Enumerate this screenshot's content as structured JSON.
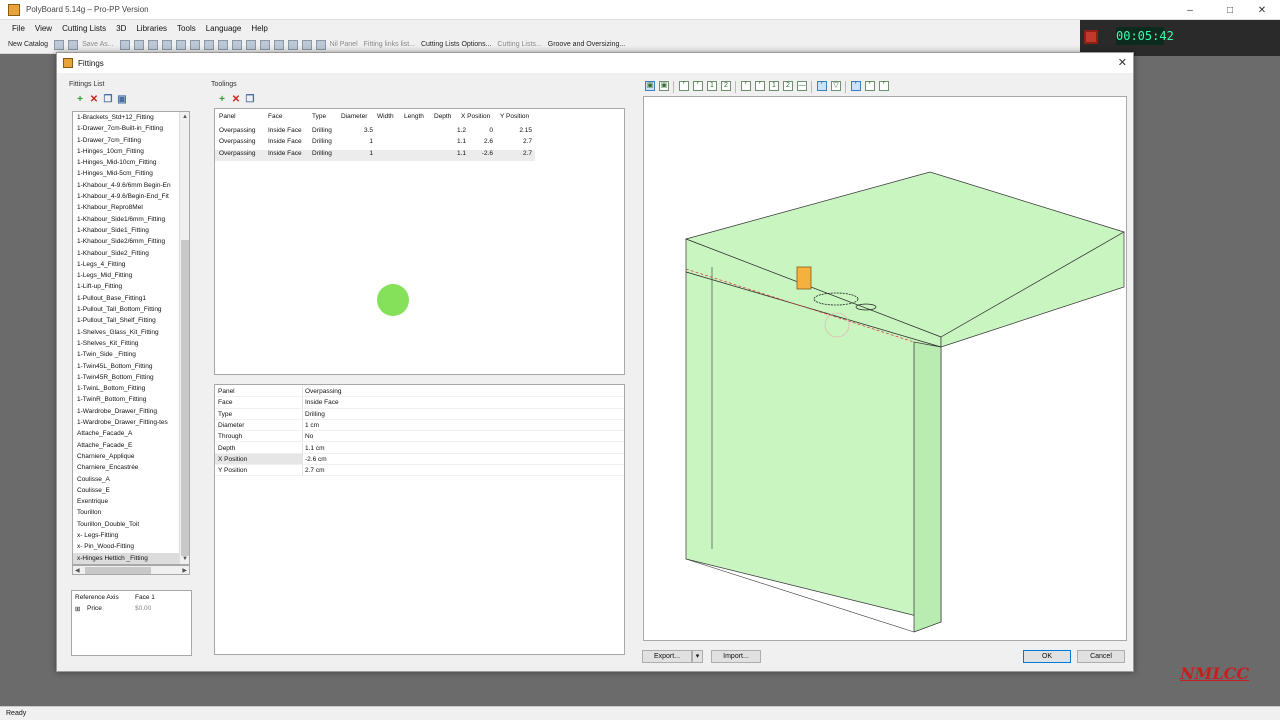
{
  "app": {
    "title": "PolyBoard 5.14g – Pro-PP Version",
    "menu": [
      "File",
      "View",
      "Cutting Lists",
      "3D",
      "Libraries",
      "Tools",
      "Language",
      "Help"
    ],
    "toolbar": {
      "new_catalog": "New Catalog",
      "save_as": "Save As...",
      "nil_panel": "Nil Panel",
      "fitting_links": "Fitting links list...",
      "cutting_list_options": "Cutting Lists Options...",
      "cutting_lists": "Cutting Lists...",
      "groove_oversizing": "Groove and Oversizing..."
    },
    "timer": "00:05:42",
    "status": "Ready",
    "watermark": "NMLCC"
  },
  "dialog": {
    "title": "Fittings",
    "fittings_list_label": "Fittings List",
    "toolings_label": "Toolings",
    "fittings": [
      "1-Brackets_Std+12_Fitting",
      "1-Drawer_7cm-Built-in_Fitting",
      "1-Drawer_7cm_Fitting",
      "1-Hinges_10cm_Fitting",
      "1-Hinges_Mid-10cm_Fitting",
      "1-Hinges_Mid-5cm_Fitting",
      "1-Khabour_4-9.6/6mm Begin-En",
      "1-Khabour_4-9.6/Begin-End_Fit",
      "1-Khabour_Repro8Mel",
      "1-Khabour_Side1/6mm_Fitting",
      "1-Khabour_Side1_Fitting",
      "1-Khabour_Side2/6mm_Fitting",
      "1-Khabour_Side2_Fitting",
      "1-Legs_4_Fitting",
      "1-Legs_Mid_Fitting",
      "1-Lift-up_Fitting",
      "1-Pullout_Base_Fitting1",
      "1-Pullout_Tall_Bottom_Fitting",
      "1-Pullout_Tall_Shelf_Fitting",
      "1-Shelves_Glass_Kit_Fitting",
      "1-Shelves_Kit_Fitting",
      "1-Twin_Side _Fitting",
      "1-Twin45L_Bottom_Fitting",
      "1-Twin45R_Bottom_Fitting",
      "1-TwinL_Bottom_Fitting",
      "1-TwinR_Bottom_Fitting",
      "1-Wardrobe_Drawer_Fitting",
      "1-Wardrobe_Drawer_Fitting-tes",
      "Attache_Facade_A",
      "Attache_Facade_E",
      "Charniere_Applique",
      "Charniere_Encastrée",
      "Coulisse_A",
      "Coulisse_E",
      "Exentrique",
      "Tourillon",
      "Tourillon_Double_Toit",
      "x- Legs-Fitting",
      "x- Pin_Wood-Fitting",
      "x-Hinges Hettich _Fitting"
    ],
    "selected_fitting_index": 39,
    "reference": {
      "label": "Reference Axis",
      "value": "Face 1",
      "price_label": "Price",
      "price_value": "$0.00"
    },
    "toolings": {
      "headers": [
        "Panel",
        "Face",
        "Type",
        "Diameter",
        "Width",
        "Length",
        "Depth",
        "X Position",
        "Y Position"
      ],
      "rows": [
        [
          "Overpassing",
          "Inside Face",
          "Drilling",
          "3.5",
          "",
          "",
          "1.2",
          "0",
          "2.15"
        ],
        [
          "Overpassing",
          "Inside Face",
          "Drilling",
          "1",
          "",
          "",
          "1.1",
          "2.6",
          "2.7"
        ],
        [
          "Overpassing",
          "Inside Face",
          "Drilling",
          "1",
          "",
          "",
          "1.1",
          "-2.6",
          "2.7"
        ]
      ],
      "selected_row": 2
    },
    "properties": [
      {
        "key": "Panel",
        "value": "Overpassing"
      },
      {
        "key": "Face",
        "value": "Inside Face"
      },
      {
        "key": "Type",
        "value": "Drilling"
      },
      {
        "key": "Diameter",
        "value": "1 cm"
      },
      {
        "key": "Through",
        "value": "No"
      },
      {
        "key": "Depth",
        "value": "1.1 cm"
      },
      {
        "key": "X Position",
        "value": "-2.6 cm"
      },
      {
        "key": "Y Position",
        "value": "2.7 cm"
      }
    ],
    "selected_property": 6,
    "buttons": {
      "export": "Export...",
      "import": "Import...",
      "ok": "OK",
      "cancel": "Cancel"
    },
    "colors": {
      "panel_fill": "#c8f5c0",
      "panel_stroke": "#333333",
      "accent": "#0078d7"
    }
  }
}
